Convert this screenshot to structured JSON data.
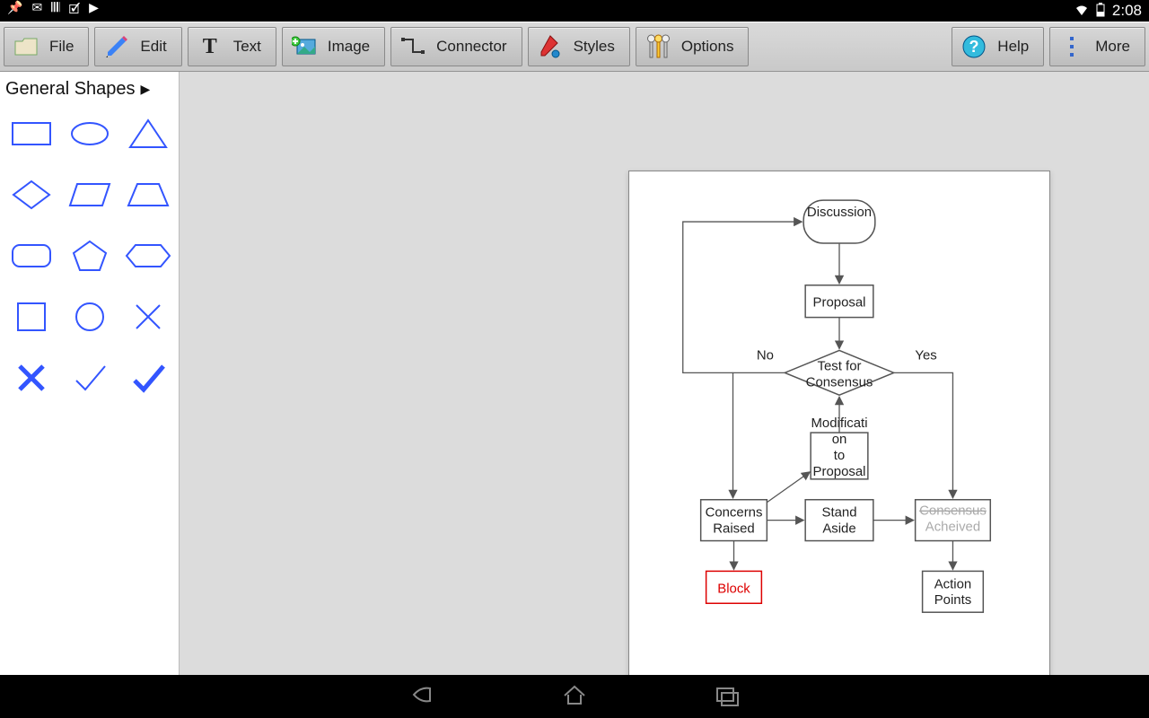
{
  "statusbar": {
    "time": "2:08"
  },
  "toolbar": {
    "file": "File",
    "edit": "Edit",
    "text": "Text",
    "image": "Image",
    "connector": "Connector",
    "styles": "Styles",
    "options": "Options",
    "help": "Help",
    "more": "More"
  },
  "sidebar": {
    "header": "General Shapes"
  },
  "flowchart": {
    "discussion": "Discussion",
    "proposal": "Proposal",
    "test_line1": "Test for",
    "test_line2": "Consensus",
    "no": "No",
    "yes": "Yes",
    "modif_l1": "Modificati",
    "modif_l2": "on",
    "modif_l3": "to",
    "modif_l4": "Proposal",
    "concerns_l1": "Concerns",
    "concerns_l2": "Raised",
    "stand_l1": "Stand",
    "stand_l2": "Aside",
    "consensus_l1": "Consensus",
    "consensus_l2": "Acheived",
    "block": "Block",
    "action_l1": "Action",
    "action_l2": "Points"
  }
}
